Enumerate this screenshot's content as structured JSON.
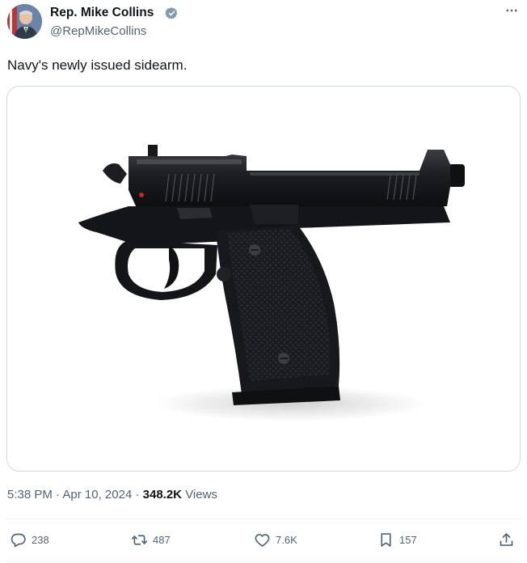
{
  "author": {
    "display_name": "Rep. Mike Collins",
    "handle": "@RepMikeCollins",
    "verified_icon": "verified-badge-icon"
  },
  "more_icon": "more-horizontal-icon",
  "tweet": {
    "text": "Navy's newly issued sidearm.",
    "time": "5:38 PM",
    "separator": "·",
    "date": "Apr 10, 2024",
    "views_count": "348.2K",
    "views_label": "Views"
  },
  "actions": {
    "replies": "238",
    "reposts": "487",
    "likes": "7.6K",
    "bookmarks": "157"
  },
  "colors": {
    "text_primary": "#0f1419",
    "text_secondary": "#536471",
    "border": "#cfd9de",
    "verified": "#829aab"
  }
}
